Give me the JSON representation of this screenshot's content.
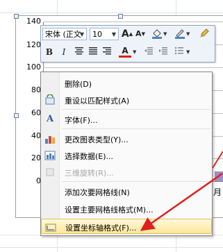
{
  "chart": {
    "y_ticks": [
      "140",
      "120",
      "100",
      "80",
      "60",
      "40",
      "20",
      "0"
    ],
    "x_label_partial": "月",
    "series_color": "#9b8fc8",
    "accent_bar_color": "#9bbb59"
  },
  "mini_toolbar": {
    "font_name": "宋体 (正文",
    "font_size": "10",
    "grow_font_icon": "A",
    "shrink_font_icon": "A",
    "bold": "B",
    "italic": "I",
    "font_color_icon": "A"
  },
  "context_menu": {
    "items": [
      {
        "label": "删除(D)",
        "icon": "",
        "disabled": false
      },
      {
        "label": "重设以匹配样式(A)",
        "icon": "reset-style-icon",
        "disabled": false
      },
      {
        "label": "字体(F)...",
        "icon": "font-icon",
        "disabled": false
      },
      {
        "label": "更改图表类型(Y)...",
        "icon": "chart-type-icon",
        "disabled": false
      },
      {
        "label": "选择数据(E)...",
        "icon": "select-data-icon",
        "disabled": false
      },
      {
        "label": "三维旋转(R)...",
        "icon": "3d-rotation-icon",
        "disabled": true
      },
      {
        "label": "添加次要网格线(N)",
        "icon": "",
        "disabled": false
      },
      {
        "label": "设置主要网格线格式(M)...",
        "icon": "",
        "disabled": false
      },
      {
        "label": "设置坐标轴格式(F)...",
        "icon": "format-axis-icon",
        "disabled": false
      }
    ]
  },
  "colors": {
    "highlight": "#ffe79a",
    "arrow": "#e0201b"
  }
}
